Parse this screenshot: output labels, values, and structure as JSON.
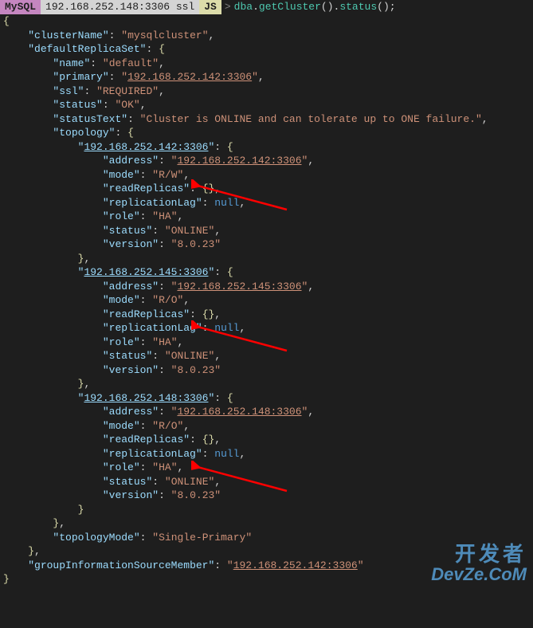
{
  "prompt": {
    "mysql": "MySQL",
    "host": "192.168.252.148:3306 ssl",
    "js": "JS",
    "gt": ">",
    "command": "dba.getCluster().status();"
  },
  "output": {
    "clusterName_key": "clusterName",
    "clusterName_val": "mysqlcluster",
    "defaultReplicaSet_key": "defaultReplicaSet",
    "name_key": "name",
    "name_val": "default",
    "primary_key": "primary",
    "primary_val": "192.168.252.142:3306",
    "ssl_key": "ssl",
    "ssl_val": "REQUIRED",
    "status_key": "status",
    "status_val": "OK",
    "statusText_key": "statusText",
    "statusText_val": "Cluster is ONLINE and can tolerate up to ONE failure.",
    "topology_key": "topology",
    "node1_key": "192.168.252.142:3306",
    "address_key": "address",
    "node1_address": "192.168.252.142:3306",
    "mode_key": "mode",
    "node1_mode": "R/W",
    "readReplicas_key": "readReplicas",
    "replicationLag_key": "replicationLag",
    "null_val": "null",
    "role_key": "role",
    "role_val": "HA",
    "nodestatus_val": "ONLINE",
    "version_key": "version",
    "version_val": "8.0.23",
    "node2_key": "192.168.252.145:3306",
    "node2_address": "192.168.252.145:3306",
    "node2_mode": "R/O",
    "node3_key": "192.168.252.148:3306",
    "node3_address": "192.168.252.148:3306",
    "node3_mode": "R/O",
    "topologyMode_key": "topologyMode",
    "topologyMode_val": "Single-Primary",
    "gism_key": "groupInformationSourceMember",
    "gism_val": "192.168.252.142:3306"
  },
  "watermark": {
    "cn": "开发者",
    "en": "DevZe.CoM"
  }
}
